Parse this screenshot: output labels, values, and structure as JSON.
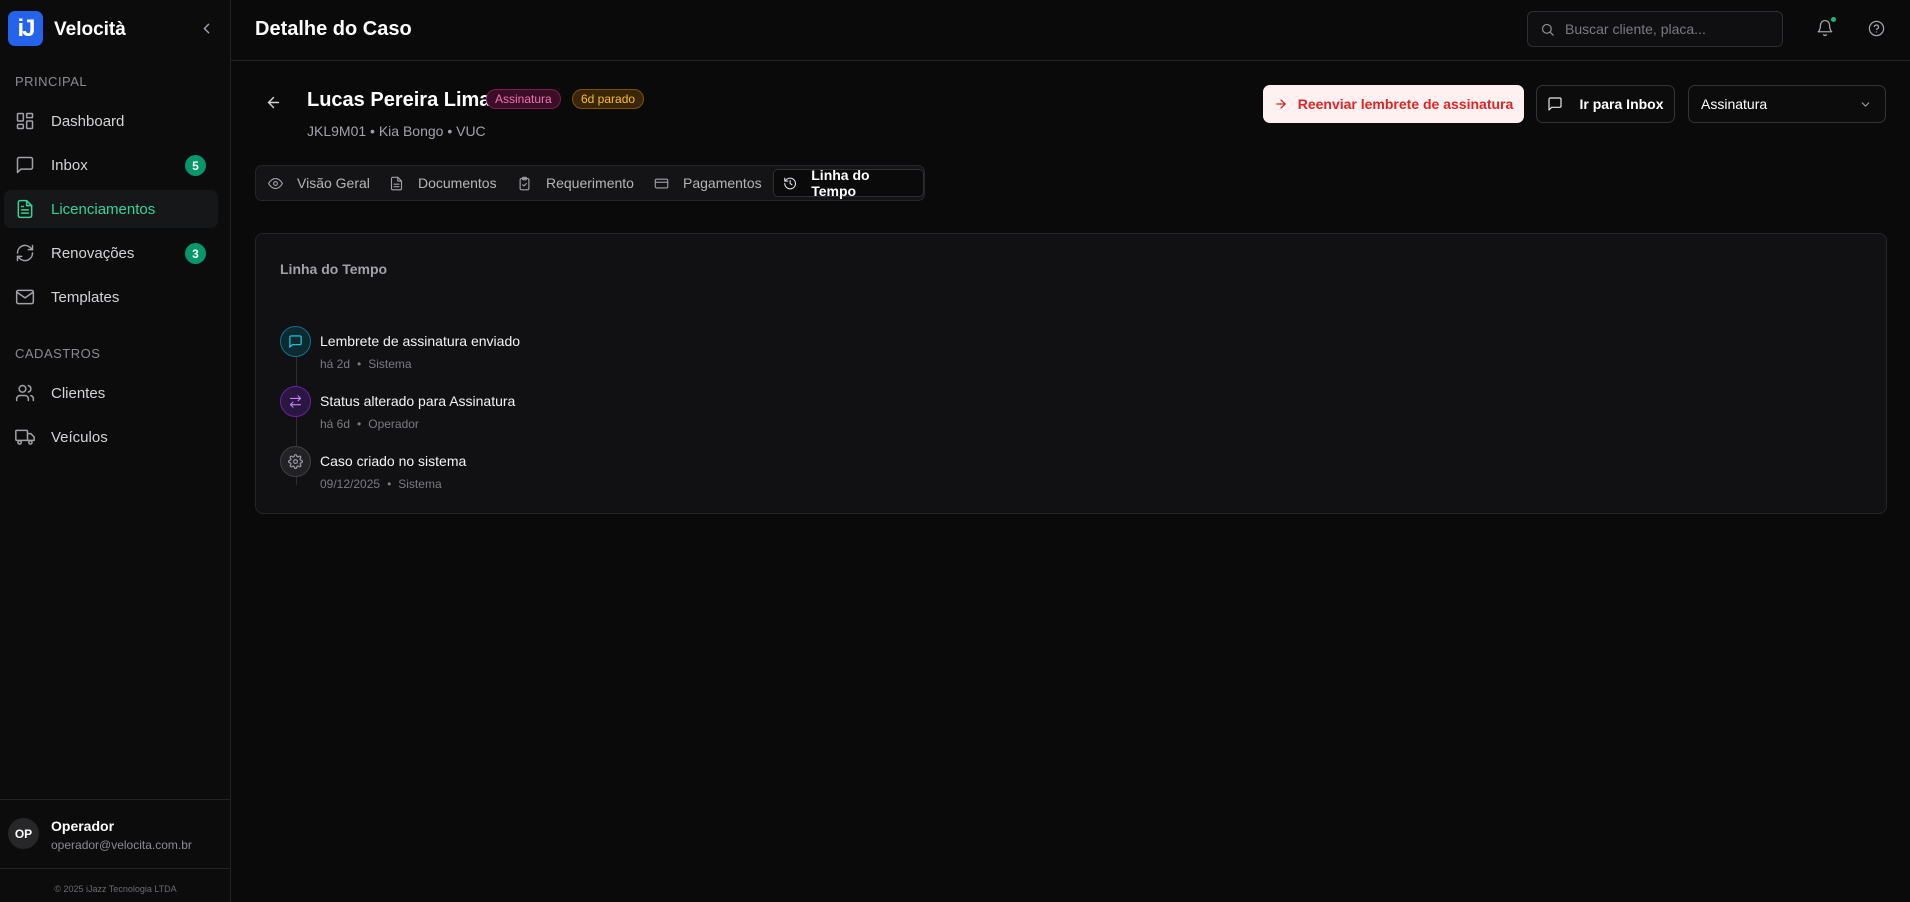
{
  "app": {
    "brand_mark": "iJ",
    "brand_name": "Velocità"
  },
  "sidebar": {
    "section_principal": "PRINCIPAL",
    "section_cadastros": "CADASTROS",
    "items": [
      {
        "label": "Dashboard",
        "icon": "dashboard-icon"
      },
      {
        "label": "Inbox",
        "icon": "message-square-icon",
        "badge": "5"
      },
      {
        "label": "Licenciamentos",
        "icon": "file-text-icon",
        "active": true
      },
      {
        "label": "Renovações",
        "icon": "refresh-icon",
        "badge": "3"
      },
      {
        "label": "Templates",
        "icon": "mail-icon"
      },
      {
        "label": "Clientes",
        "icon": "users-icon"
      },
      {
        "label": "Veículos",
        "icon": "truck-icon"
      }
    ],
    "user": {
      "initials": "OP",
      "name": "Operador",
      "email": "operador@velocita.com.br"
    },
    "footer": "© 2025 iJazz Tecnologia LTDA"
  },
  "header": {
    "title": "Detalhe do Caso",
    "search_placeholder": "Buscar cliente, placa..."
  },
  "case": {
    "client_name": "Lucas Pereira Lima",
    "status_badge": "Assinatura",
    "stalled_badge": "6d parado",
    "vehicle_line": "JKL9M01 • Kia Bongo • VUC",
    "reminder_button": "Reenviar lembrete de assinatura",
    "inbox_button": "Ir para Inbox",
    "status_select": "Assinatura"
  },
  "tabs": [
    {
      "label": "Visão Geral",
      "icon": "eye-icon"
    },
    {
      "label": "Documentos",
      "icon": "document-icon"
    },
    {
      "label": "Requerimento",
      "icon": "clipboard-check-icon"
    },
    {
      "label": "Pagamentos",
      "icon": "credit-card-icon"
    },
    {
      "label": "Linha do Tempo",
      "icon": "history-icon",
      "active": true
    }
  ],
  "timeline": {
    "title": "Linha do Tempo",
    "events": [
      {
        "title": "Lembrete de assinatura enviado",
        "time": "há 2d",
        "actor": "Sistema",
        "icon": "message-icon",
        "color": "#22d3ee"
      },
      {
        "title": "Status alterado para Assinatura",
        "time": "há 6d",
        "actor": "Operador",
        "icon": "arrows-swap-icon",
        "color": "#c084fc"
      },
      {
        "title": "Caso criado no sistema",
        "time": "09/12/2025",
        "actor": "Sistema",
        "icon": "gear-icon",
        "color": "#a1a1aa"
      }
    ]
  },
  "colors": {
    "accent_green": "#34d399",
    "badge_green": "#059669",
    "brand_blue": "#2563eb",
    "danger_red": "#dc2626",
    "status_pink": "#f472b6",
    "stalled_amber": "#fbbf24"
  }
}
